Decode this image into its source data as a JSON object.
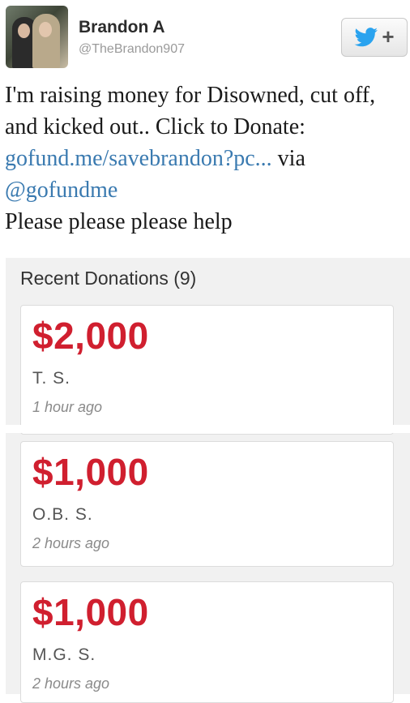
{
  "tweet": {
    "display_name": "Brandon A",
    "handle": "@TheBrandon907",
    "text_line1": "I'm raising money for Disowned, cut off, and kicked out.. Click to Donate: ",
    "link": "gofund.me/savebrandon?pc...",
    "via": " via ",
    "mention": "@gofundme",
    "text_line2": "Please please please help",
    "follow_button_icon": "twitter-bird-icon",
    "follow_button_plus": "+",
    "accent_color": "#3a7ab0"
  },
  "donations": {
    "heading": "Recent Donations (9)",
    "amount_color": "#d01f2f",
    "items": [
      {
        "amount": "$2,000",
        "donor": "T. S.",
        "time": "1 hour ago"
      },
      {
        "amount": "$1,000",
        "donor": "O.B. S.",
        "time": "2 hours ago"
      },
      {
        "amount": "$1,000",
        "donor": "M.G. S.",
        "time": "2 hours ago"
      }
    ]
  }
}
